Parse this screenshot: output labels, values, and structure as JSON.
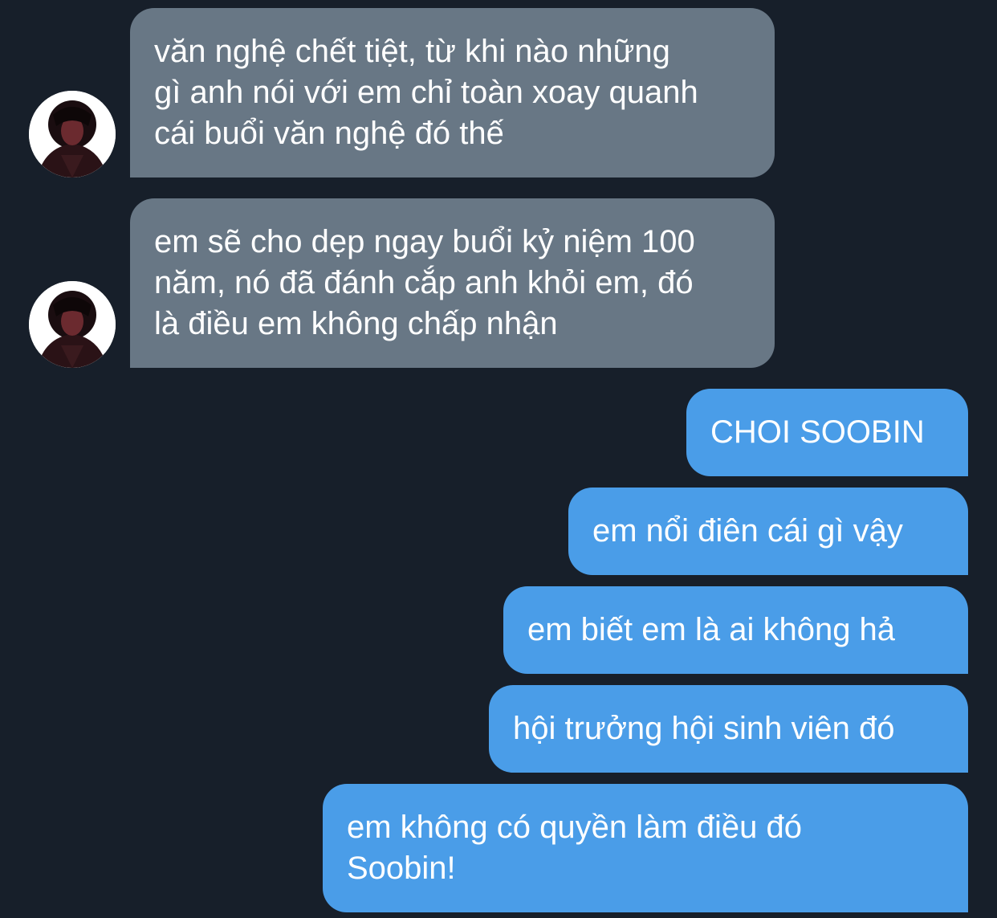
{
  "conversation": {
    "incoming": [
      {
        "avatar": "user-avatar-photo",
        "text": "văn nghệ chết tiệt, từ khi nào những\ngì anh nói với em chỉ toàn xoay quanh\ncái buổi văn nghệ đó thế"
      },
      {
        "avatar": "user-avatar-photo",
        "text": "em sẽ cho dẹp ngay buổi kỷ niệm 100\nnăm, nó đã đánh cắp anh khỏi em, đó\nlà điều em không chấp nhận"
      }
    ],
    "outgoing": [
      {
        "text": "CHOI SOOBIN"
      },
      {
        "text": "em nổi điên cái gì vậy"
      },
      {
        "text": "em biết em là ai không hả"
      },
      {
        "text": "hội trưởng hội sinh viên đó"
      },
      {
        "text": "em không có quyền làm điều đó\nSoobin!"
      }
    ]
  },
  "colors": {
    "background": "#171f2a",
    "incoming_bubble": "#687785",
    "outgoing_bubble": "#4a9de8",
    "text": "#ffffff"
  }
}
